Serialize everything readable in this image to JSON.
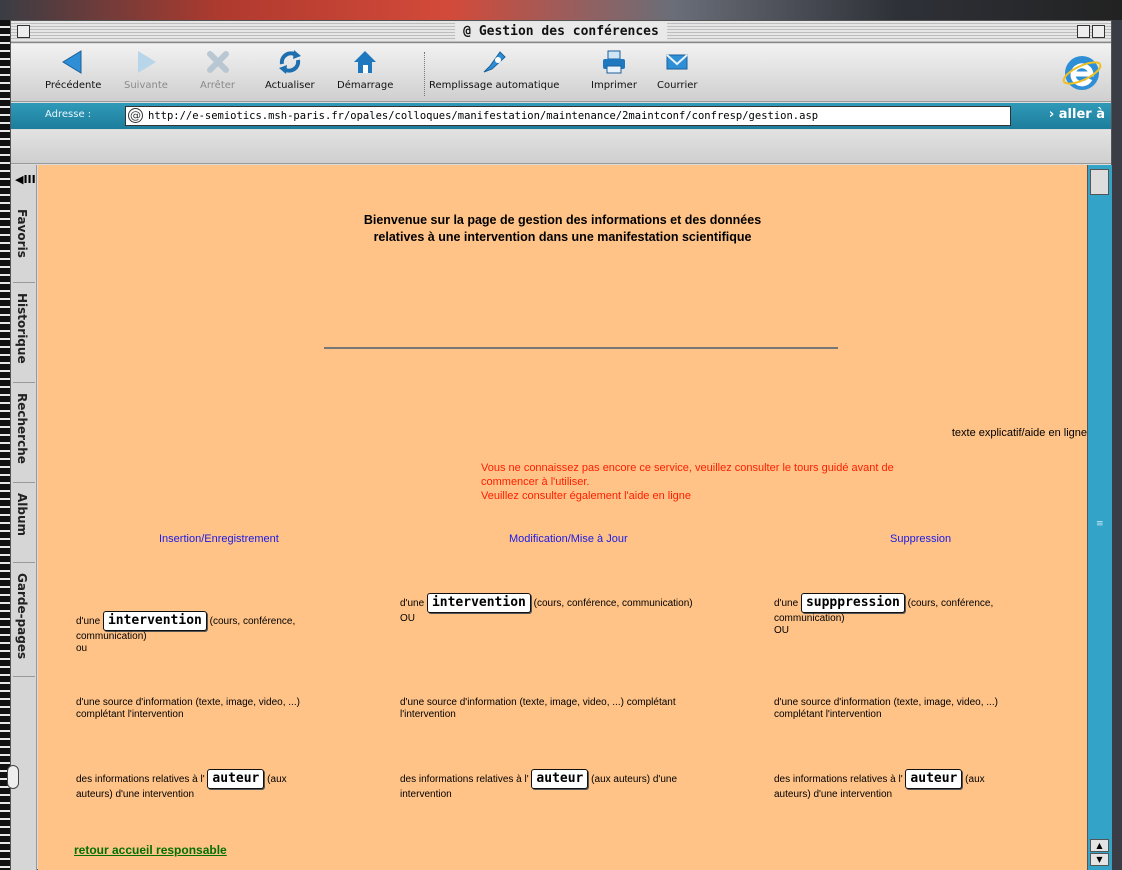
{
  "window": {
    "title": "@ Gestion des conférences"
  },
  "toolbar": {
    "buttons": [
      {
        "label": "Précédente",
        "icon": "back-arrow-icon",
        "enabled": true
      },
      {
        "label": "Suivante",
        "icon": "forward-arrow-icon",
        "enabled": false
      },
      {
        "label": "Arrêter",
        "icon": "stop-x-icon",
        "enabled": false
      },
      {
        "label": "Actualiser",
        "icon": "refresh-icon",
        "enabled": true
      },
      {
        "label": "Démarrage",
        "icon": "home-icon",
        "enabled": true
      },
      {
        "label": "Remplissage automatique",
        "icon": "autofill-icon",
        "enabled": true
      },
      {
        "label": "Imprimer",
        "icon": "printer-icon",
        "enabled": true
      },
      {
        "label": "Courrier",
        "icon": "mail-icon",
        "enabled": true
      }
    ]
  },
  "address": {
    "label": "Adresse :",
    "url": "http://e-semiotics.msh-paris.fr/opales/colloques/manifestation/maintenance/2maintconf/confresp/gestion.asp",
    "go": "› aller à"
  },
  "sidebar": {
    "tabs": [
      "Favoris",
      "Historique",
      "Recherche",
      "Album",
      "Garde-pages"
    ]
  },
  "page": {
    "heading_line1": "Bienvenue sur la page de gestion des informations et des données",
    "heading_line2": "relatives à une intervention dans une manifestation scientifique",
    "aide": "texte explicatif/aide en ligne",
    "notice_line1": "Vous ne connaissez pas encore ce service, veuillez consulter le tours guidé avant de",
    "notice_line2": "commencer à l'utiliser.",
    "notice_line3": "Veuillez consulter également l'aide en ligne",
    "col_insert": "Insertion/Enregistrement",
    "col_modify": "Modification/Mise à Jour",
    "col_delete": "Suppression",
    "dune": "d'une",
    "btn_intervention": "intervention",
    "btn_suppression": "supppression",
    "btn_auteur": "auteur",
    "cours_conf_comm": "(cours, conférence, communication)",
    "cours_conf": "(cours, conférence,",
    "communication": "communication)",
    "ou": "ou",
    "OU": "OU",
    "source_full": "d'une source d'information (texte, image, video, ...) complétant",
    "source_l1": "d'une source d'information (texte, image, video, ...)",
    "source_l2": "complétant l'intervention",
    "source_rest": "l'intervention",
    "infos_prefix": "des informations relatives à l'",
    "aux": "(aux",
    "aux_full": "(aux auteurs) d'une",
    "auteurs_dune": "auteurs) d'une intervention",
    "intervention_word": "intervention",
    "retour": "retour accueil responsable"
  },
  "colors": {
    "page_bg": "#ffc388",
    "notice": "#ff1e00",
    "column_heading": "#1a1ae6",
    "link": "#007000",
    "addressbar": "#1d7d9c"
  }
}
